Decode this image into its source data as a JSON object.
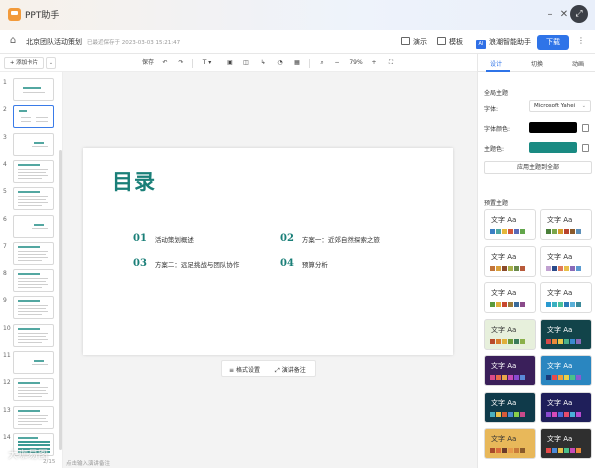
{
  "app": {
    "title": "PPT助手"
  },
  "window": {
    "minimize": "–",
    "close": "✕",
    "expand": "⤢"
  },
  "menubar": {
    "doc_title": "北京团队活动策划",
    "save_status": "已最近保存于 2023-03-03 15:21:47",
    "present": "演示",
    "template": "模板",
    "ai": "浪潮智能助手",
    "ai_icon": "AI",
    "download": "下载",
    "more": "⋮"
  },
  "toolbar": {
    "add_card": "+ 添加卡片",
    "save": "保存",
    "zoom": "79%"
  },
  "thumbnails": [
    {
      "num": "1",
      "kind": "cover"
    },
    {
      "num": "2",
      "kind": "toc",
      "selected": true
    },
    {
      "num": "3",
      "kind": "section"
    },
    {
      "num": "4",
      "kind": "content"
    },
    {
      "num": "5",
      "kind": "content"
    },
    {
      "num": "6",
      "kind": "section"
    },
    {
      "num": "7",
      "kind": "content"
    },
    {
      "num": "8",
      "kind": "content"
    },
    {
      "num": "9",
      "kind": "content"
    },
    {
      "num": "10",
      "kind": "content"
    },
    {
      "num": "11",
      "kind": "section"
    },
    {
      "num": "12",
      "kind": "content"
    },
    {
      "num": "13",
      "kind": "content"
    },
    {
      "num": "14",
      "kind": "table"
    }
  ],
  "slide": {
    "title": "目录",
    "items": [
      {
        "num": "01",
        "text": "活动策划概述"
      },
      {
        "num": "02",
        "text": "方案一：近郊自然探索之旅"
      },
      {
        "num": "03",
        "text": "方案二：远足挑战与团队协作"
      },
      {
        "num": "04",
        "text": "预算分析"
      }
    ]
  },
  "bottom_bar": {
    "format": "格式设置",
    "notes": "演讲备注"
  },
  "statusbar": {
    "page": "2/15",
    "notes_hint": "点击输入演讲备注",
    "watermark": "大咖易图"
  },
  "right_panel": {
    "tabs": [
      "设计",
      "切换",
      "动画"
    ],
    "global_theme_label": "全局主题",
    "font_label": "字体:",
    "font_value": "Microsoft Yahei",
    "font_color_label": "字体颜色:",
    "font_color": "#000000",
    "theme_color_label": "主题色:",
    "theme_color": "#1a8a82",
    "apply_all": "应用主题到全部",
    "preset_label": "预置主题",
    "themes": [
      {
        "text": "文字 Aa",
        "bg": "#ffffff",
        "fg": "#333333",
        "dots": [
          "#3b7fc4",
          "#4ca6a0",
          "#e4b73a",
          "#d2553a",
          "#5a6ab8",
          "#62a64b"
        ]
      },
      {
        "text": "文字 Aa",
        "bg": "#ffffff",
        "fg": "#333333",
        "dots": [
          "#4a7f3a",
          "#7aa64b",
          "#d79b2b",
          "#b8432e",
          "#8a5a2b",
          "#5c8fb8"
        ]
      },
      {
        "text": "文字 Aa",
        "bg": "#ffffff",
        "fg": "#333333",
        "dots": [
          "#c2743a",
          "#d9a03a",
          "#8a4a2a",
          "#a8b04a",
          "#6a8a4a",
          "#b85a3a"
        ]
      },
      {
        "text": "文字 Aa",
        "bg": "#ffffff",
        "fg": "#333333",
        "dots": [
          "#c0a0d0",
          "#2a4a8a",
          "#e07a5a",
          "#e8c04a",
          "#8a6ab8",
          "#5a9ad0"
        ]
      },
      {
        "text": "文字 Aa",
        "bg": "#ffffff",
        "fg": "#333333",
        "dots": [
          "#5a9a3a",
          "#e0b03a",
          "#c8482e",
          "#9a7a3a",
          "#3a6a9a",
          "#8a4a8a"
        ]
      },
      {
        "text": "文字 Aa",
        "bg": "#ffffff",
        "fg": "#333333",
        "dots": [
          "#2a9ad0",
          "#3ab0c0",
          "#4ac09a",
          "#2a7ab8",
          "#5ab0d8",
          "#3a8a9a"
        ]
      },
      {
        "text": "文字 Aa",
        "bg": "#e7f0dc",
        "fg": "#333333",
        "dots": [
          "#b84a2a",
          "#d87a2a",
          "#e0b03a",
          "#6a9a3a",
          "#3a7a5a",
          "#8ab04a"
        ]
      },
      {
        "text": "文字 Aa",
        "bg": "#12444a",
        "fg": "#ffffff",
        "dots": [
          "#d84a4a",
          "#e88a3a",
          "#e8c84a",
          "#4ab08a",
          "#3a8ad0",
          "#8a6ab8"
        ]
      },
      {
        "text": "文字 Aa",
        "bg": "#3a1f5a",
        "fg": "#ffffff",
        "dots": [
          "#d84a8a",
          "#e86a4a",
          "#e8a84a",
          "#c84ab8",
          "#8a4ad0",
          "#5a8ad8"
        ]
      },
      {
        "text": "文字 Aa",
        "bg": "#2a86c0",
        "fg": "#ffffff",
        "dots": [
          "#1a3a7a",
          "#e84a4a",
          "#f0a03a",
          "#e8d04a",
          "#4ac08a",
          "#8a5ad0"
        ]
      },
      {
        "text": "文字 Aa",
        "bg": "#0f3a4a",
        "fg": "#ffffff",
        "dots": [
          "#4ab0c0",
          "#e8c04a",
          "#d85a3a",
          "#4a8ad0",
          "#8ad04a",
          "#c84a8a"
        ]
      },
      {
        "text": "文字 Aa",
        "bg": "#1f1f5a",
        "fg": "#ffffff",
        "dots": [
          "#8a4ad0",
          "#d84ab8",
          "#4a6ad8",
          "#e84a6a",
          "#4ab0d8",
          "#b84ad0"
        ]
      },
      {
        "text": "文字 Aa",
        "bg": "#e8b85a",
        "fg": "#333333",
        "dots": [
          "#a84a2a",
          "#d86a3a",
          "#6a3a2a",
          "#e89a4a",
          "#c87a3a",
          "#8a5a2a"
        ]
      },
      {
        "text": "文字 Aa",
        "bg": "#2f2f2f",
        "fg": "#ffffff",
        "dots": [
          "#e84a4a",
          "#4a8ad8",
          "#e8c04a",
          "#4ac08a",
          "#c84ab8",
          "#e88a3a"
        ]
      }
    ]
  }
}
